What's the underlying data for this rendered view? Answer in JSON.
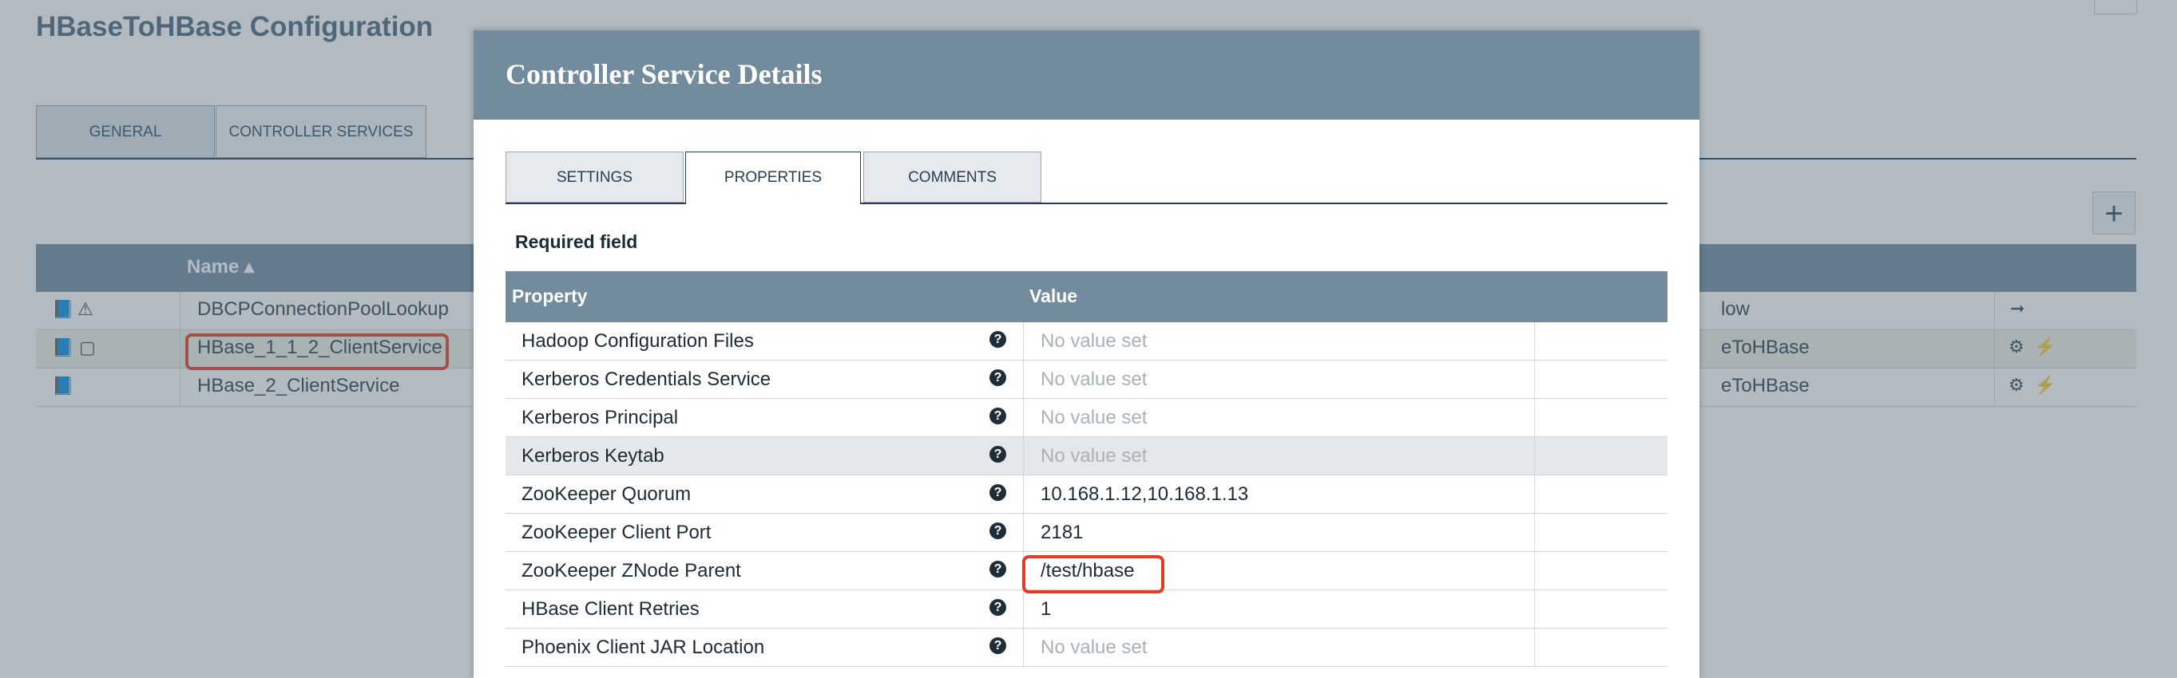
{
  "background": {
    "title": "HBaseToHBase Configuration",
    "tabs": [
      "GENERAL",
      "CONTROLLER SERVICES"
    ],
    "table_header": {
      "name": "Name ▴"
    },
    "rows": [
      {
        "name": "DBCPConnectionPoolLookup",
        "scope": "low"
      },
      {
        "name": "HBase_1_1_2_ClientService",
        "scope": "eToHBase"
      },
      {
        "name": "HBase_2_ClientService",
        "scope": "eToHBase"
      }
    ],
    "icons": {
      "doc": "📘",
      "warn": "⚠",
      "note": "▢",
      "gear": "⚙",
      "arrow": "➞",
      "bolt": "⚡",
      "add": "+"
    }
  },
  "dialog": {
    "title": "Controller Service Details",
    "tabs": [
      "SETTINGS",
      "PROPERTIES",
      "COMMENTS"
    ],
    "active_tab": "PROPERTIES",
    "required_label": "Required field",
    "table": {
      "headers": {
        "property": "Property",
        "value": "Value"
      },
      "rows": [
        {
          "property": "Hadoop Configuration Files",
          "value": "No value set"
        },
        {
          "property": "Kerberos Credentials Service",
          "value": "No value set"
        },
        {
          "property": "Kerberos Principal",
          "value": "No value set"
        },
        {
          "property": "Kerberos Keytab",
          "value": "No value set"
        },
        {
          "property": "ZooKeeper Quorum",
          "value": "10.168.1.12,10.168.1.13"
        },
        {
          "property": "ZooKeeper Client Port",
          "value": "2181"
        },
        {
          "property": "ZooKeeper ZNode Parent",
          "value": "/test/hbase"
        },
        {
          "property": "HBase Client Retries",
          "value": "1"
        },
        {
          "property": "Phoenix Client JAR Location",
          "value": "No value set"
        }
      ]
    }
  },
  "colors": {
    "header": "#728c9e",
    "highlight": "#e53c21",
    "dark": "#1f3d52"
  }
}
